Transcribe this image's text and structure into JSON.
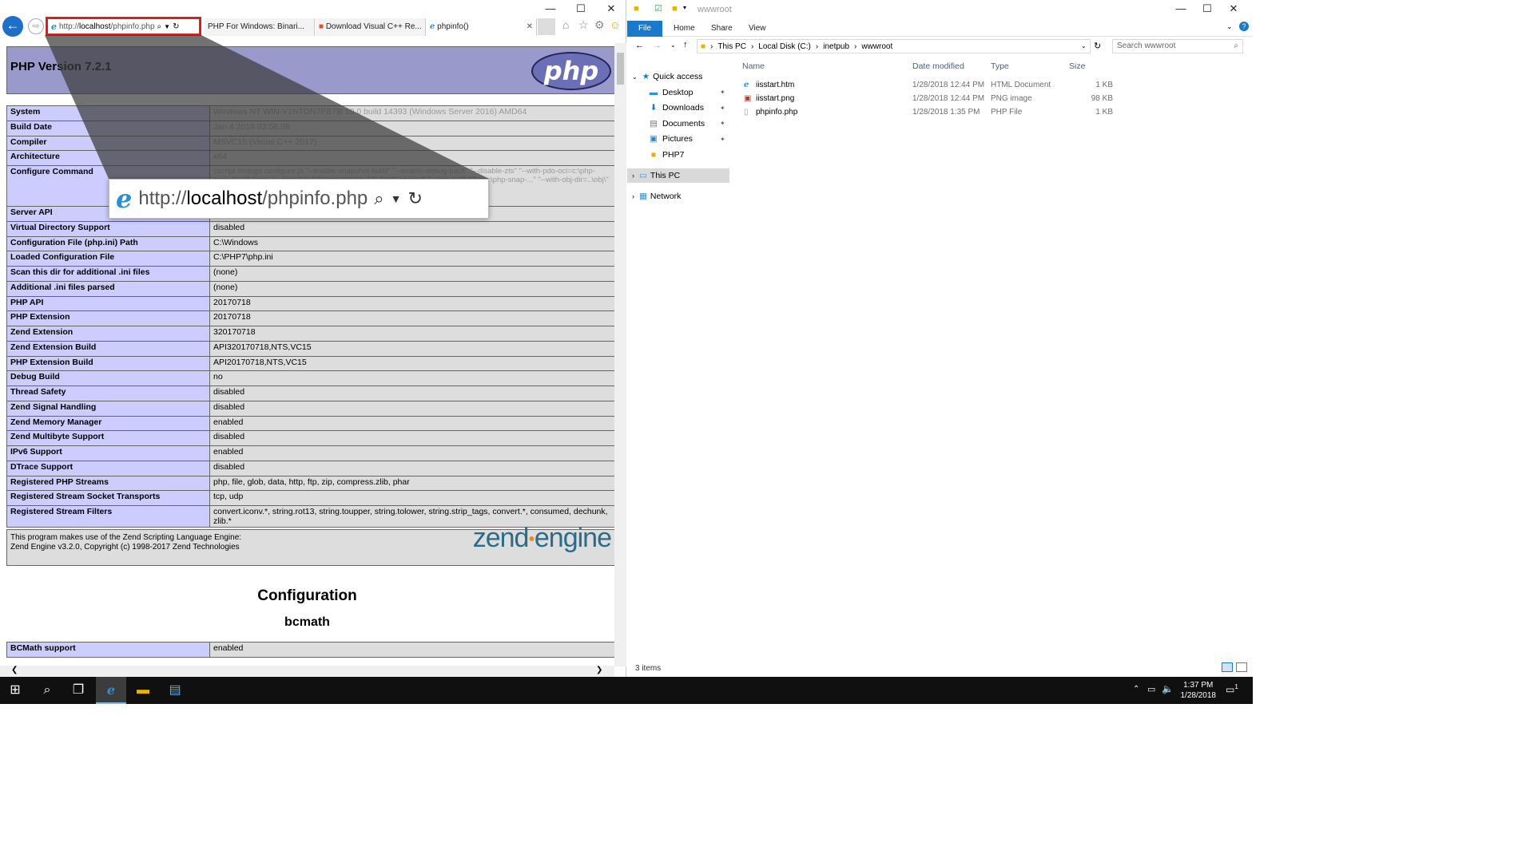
{
  "ie": {
    "url_prefix": "http://",
    "url_host": "localhost",
    "url_path": "/phpinfo.php",
    "tabs": [
      "PHP For Windows: Binari...",
      "Download Visual C++ Re...",
      "phpinfo()"
    ],
    "caption_min": "—",
    "caption_max": "☐",
    "caption_close": "✕",
    "header_title": "PHP Version 7.2.1",
    "php_logo": "php",
    "rows": [
      [
        "System",
        "Windows NT WIN-V1NTON7PBTB 10.0 build 14393 (Windows Server 2016) AMD64"
      ],
      [
        "Build Date",
        "Jan 4 2018 03:56:08"
      ],
      [
        "Compiler",
        "MSVC15 (Visual C++ 2017)"
      ],
      [
        "Architecture",
        "x64"
      ],
      [
        "Configure Command",
        "cscript /nologo configure.js \"--enable-snapshot-build\" \"--enable-debug-pack\" \"--disable-zts\" \"--with-pdo-oci=c:\\php-snap-build\\deps_aux\\oracle\\x64\\instantclient_12_1\\sdk,shared\" \"--with-oci8-12c=c:\\php-snap-...\" \"--with-obj-dir=..\\obj\\\" \"--enable-com-"
      ],
      [
        "Server API",
        ""
      ],
      [
        "Virtual Directory Support",
        "disabled"
      ],
      [
        "Configuration File (php.ini) Path",
        "C:\\Windows"
      ],
      [
        "Loaded Configuration File",
        "C:\\PHP7\\php.ini"
      ],
      [
        "Scan this dir for additional .ini files",
        "(none)"
      ],
      [
        "Additional .ini files parsed",
        "(none)"
      ],
      [
        "PHP API",
        "20170718"
      ],
      [
        "PHP Extension",
        "20170718"
      ],
      [
        "Zend Extension",
        "320170718"
      ],
      [
        "Zend Extension Build",
        "API320170718,NTS,VC15"
      ],
      [
        "PHP Extension Build",
        "API20170718,NTS,VC15"
      ],
      [
        "Debug Build",
        "no"
      ],
      [
        "Thread Safety",
        "disabled"
      ],
      [
        "Zend Signal Handling",
        "disabled"
      ],
      [
        "Zend Memory Manager",
        "enabled"
      ],
      [
        "Zend Multibyte Support",
        "disabled"
      ],
      [
        "IPv6 Support",
        "enabled"
      ],
      [
        "DTrace Support",
        "disabled"
      ],
      [
        "Registered PHP Streams",
        "php, file, glob, data, http, ftp, zip, compress.zlib, phar"
      ],
      [
        "Registered Stream Socket Transports",
        "tcp, udp"
      ],
      [
        "Registered Stream Filters",
        "convert.iconv.*, string.rot13, string.toupper, string.tolower, string.strip_tags, convert.*, consumed, dechunk, zlib.*"
      ]
    ],
    "zend_line1": "This program makes use of the Zend Scripting Language Engine:",
    "zend_line2": "Zend Engine v3.2.0, Copyright (c) 1998-2017 Zend Technologies",
    "zend_logo_a": "zend",
    "zend_logo_b": "engine",
    "config_heading": "Configuration",
    "bcmath_heading": "bcmath",
    "bcmath_row": [
      "BCMath support",
      "enabled"
    ]
  },
  "explorer": {
    "title": "wwwroot",
    "ribbon": [
      "File",
      "Home",
      "Share",
      "View"
    ],
    "path": [
      "This PC",
      "Local Disk (C:)",
      "inetpub",
      "wwwroot"
    ],
    "search_placeholder": "Search wwwroot",
    "nav": [
      "Quick access",
      "Desktop",
      "Downloads",
      "Documents",
      "Pictures",
      "PHP7",
      "This PC",
      "Network"
    ],
    "columns": [
      "Name",
      "Date modified",
      "Type",
      "Size"
    ],
    "files": [
      {
        "name": "iisstart.htm",
        "date": "1/28/2018 12:44 PM",
        "type": "HTML Document",
        "size": "1 KB"
      },
      {
        "name": "iisstart.png",
        "date": "1/28/2018 12:44 PM",
        "type": "PNG image",
        "size": "98 KB"
      },
      {
        "name": "phpinfo.php",
        "date": "1/28/2018 1:35 PM",
        "type": "PHP File",
        "size": "1 KB"
      }
    ],
    "status": "3 items"
  },
  "taskbar": {
    "time": "1:37 PM",
    "date": "1/28/2018",
    "notif_count": "1"
  }
}
